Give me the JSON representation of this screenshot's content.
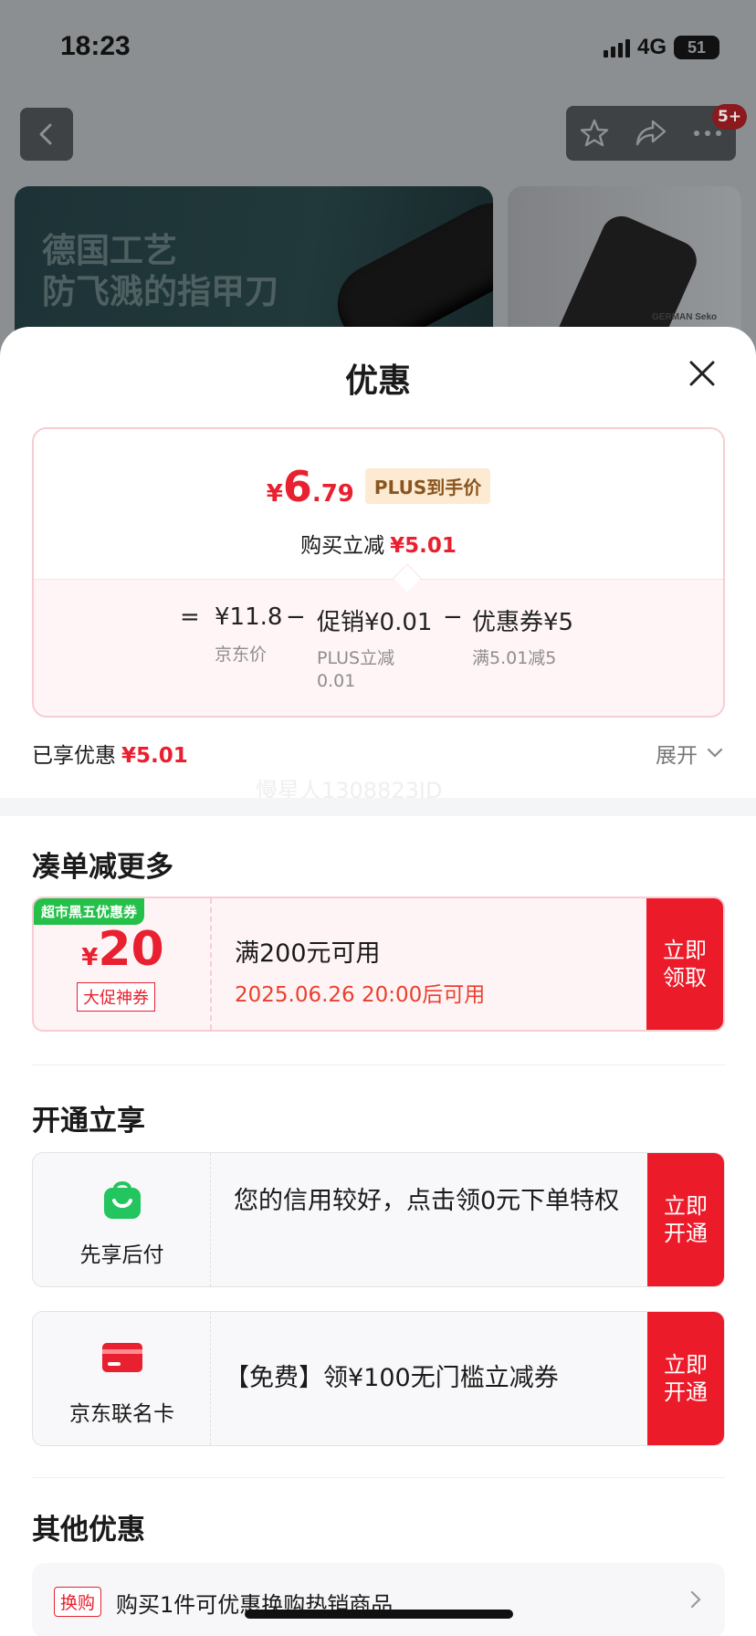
{
  "status_bar": {
    "time": "18:23",
    "network": "4G",
    "battery": "51"
  },
  "product_nav": {
    "badge": "5+"
  },
  "banner": {
    "line1": "德国工艺",
    "line2": "防飞溅的指甲刀",
    "side_brand": "GERMAN Seko"
  },
  "sheet": {
    "title": "优惠",
    "summary": {
      "price_symbol": "¥",
      "price_int": "6",
      "price_dec": ".79",
      "plus_tag": "PLUS到手价",
      "instant_label": "购买立减",
      "instant_amount": "¥5.01",
      "formula": {
        "eq": "=",
        "base_price": "¥11.8",
        "base_label": "京东价",
        "minus1": "−",
        "promo": "促销¥0.01",
        "promo_label_1": "PLUS立减",
        "promo_label_2": "0.01",
        "minus2": "−",
        "coupon": "优惠券¥5",
        "coupon_label": "满5.01减5"
      }
    },
    "enjoyed_label": "已享优惠",
    "enjoyed_amount": "¥5.01",
    "expand_label": "展开",
    "watermark": "慢星人1308823JD",
    "section_more": "凑单减更多",
    "coupon": {
      "tag": "超市黑五优惠券",
      "symbol": "¥",
      "amount": "20",
      "badge": "大促神券",
      "condition": "满200元可用",
      "available_time": "2025.06.26 20:00后可用",
      "btn_line1": "立即",
      "btn_line2": "领取"
    },
    "section_open": "开通立享",
    "services": [
      {
        "name": "先享后付",
        "desc": "您的信用较好，点击领0元下单特权",
        "btn_line1": "立即",
        "btn_line2": "开通",
        "color": "#22c55e"
      },
      {
        "name": "京东联名卡",
        "desc": "【免费】领¥100无门槛立减券",
        "btn_line1": "立即",
        "btn_line2": "开通",
        "color": "#e8202f"
      }
    ],
    "section_other": "其他优惠",
    "other": {
      "tag": "换购",
      "text": "购买1件可优惠换购热销商品"
    }
  },
  "colors": {
    "accent_red": "#ec1b2a",
    "price_red": "#e8202f",
    "green": "#25c04a"
  }
}
